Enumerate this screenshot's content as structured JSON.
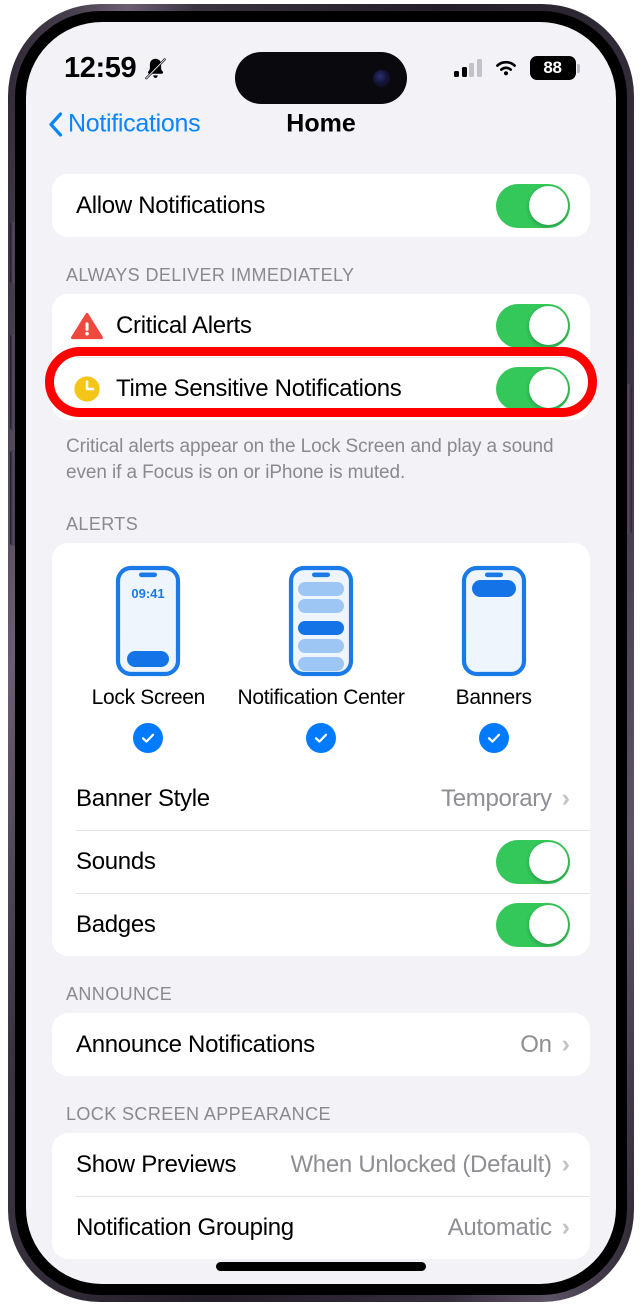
{
  "status_bar": {
    "time": "12:59",
    "silent_icon": "bell-slash-icon",
    "cellular_icon": "signal-bars-icon",
    "wifi_icon": "wifi-icon",
    "battery_level": "88"
  },
  "nav": {
    "back_label": "Notifications",
    "title": "Home"
  },
  "allow_group": {
    "rows": [
      {
        "label": "Allow Notifications",
        "toggle": "on"
      }
    ]
  },
  "deliver_section": {
    "header": "ALWAYS DELIVER IMMEDIATELY",
    "rows": [
      {
        "label": "Critical Alerts",
        "icon": "warning-triangle-icon",
        "toggle": "on"
      },
      {
        "label": "Time Sensitive Notifications",
        "icon": "clock-icon",
        "toggle": "on"
      }
    ],
    "footer": "Critical alerts appear on the Lock Screen and play a sound even if a Focus is on or iPhone is muted."
  },
  "alerts_section": {
    "header": "ALERTS",
    "options": [
      {
        "label": "Lock Screen",
        "selected": true,
        "preview_time": "09:41"
      },
      {
        "label": "Notification Center",
        "selected": true
      },
      {
        "label": "Banners",
        "selected": true
      }
    ],
    "rows": [
      {
        "label": "Banner Style",
        "value": "Temporary",
        "chevron": true
      },
      {
        "label": "Sounds",
        "toggle": "on"
      },
      {
        "label": "Badges",
        "toggle": "on"
      }
    ]
  },
  "announce_section": {
    "header": "ANNOUNCE",
    "rows": [
      {
        "label": "Announce Notifications",
        "value": "On",
        "chevron": true
      }
    ]
  },
  "lock_screen_section": {
    "header": "LOCK SCREEN APPEARANCE",
    "rows": [
      {
        "label": "Show Previews",
        "value": "When Unlocked (Default)",
        "chevron": true
      },
      {
        "label": "Notification Grouping",
        "value": "Automatic",
        "chevron": true
      }
    ]
  },
  "annotation": {
    "target": "Critical Alerts",
    "color": "#ff0000",
    "shape": "rounded-rectangle-outline"
  },
  "colors": {
    "toggle_on": "#34c759",
    "accent_blue": "#007aff",
    "link_blue": "#0a84ff",
    "critical_red": "#ff3b30",
    "time_sensitive_yellow": "#ffcc00",
    "page_background": "#f2f2f7"
  }
}
